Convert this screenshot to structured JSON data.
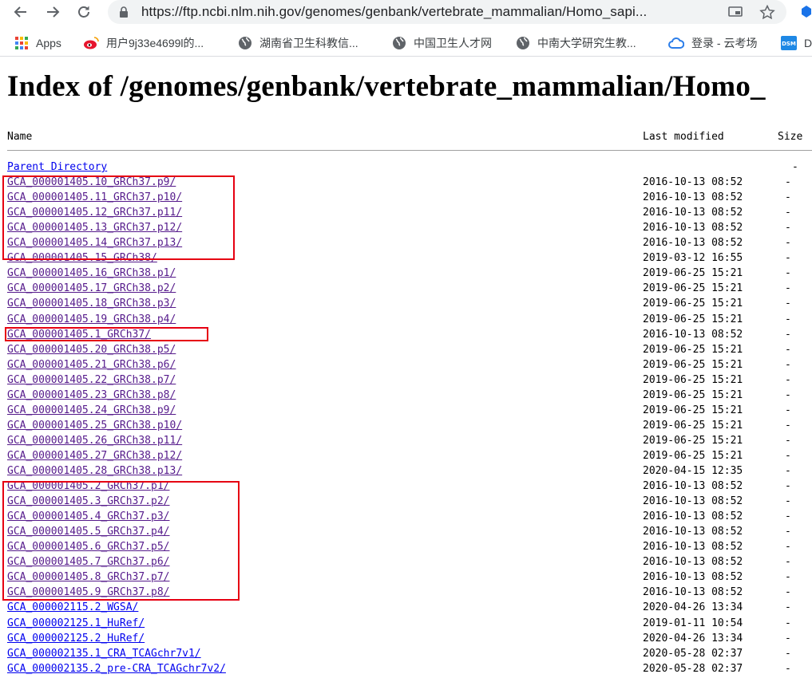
{
  "browser": {
    "url": "https://ftp.ncbi.nlm.nih.gov/genomes/genbank/vertebrate_mammalian/Homo_sapi...",
    "bookmarks": [
      {
        "label": "Apps",
        "icon": "apps-grid-icon"
      },
      {
        "label": "用户9j33e4699l的...",
        "icon": "weibo-icon"
      },
      {
        "label": "湖南省卫生科教信...",
        "icon": "globe-icon"
      },
      {
        "label": "中国卫生人才网",
        "icon": "globe-icon"
      },
      {
        "label": "中南大学研究生教...",
        "icon": "globe-icon"
      },
      {
        "label": "登录 - 云考场",
        "icon": "cloud-icon"
      },
      {
        "label": "D",
        "icon": "dsm-icon"
      }
    ],
    "colors": {
      "omnibox_bg": "#f1f3f4",
      "link_visited": "#551a8b",
      "link_unvisited": "#0000ee",
      "highlight": "#e60012"
    }
  },
  "page": {
    "title": "Index of /genomes/genbank/vertebrate_mammalian/Homo_",
    "columns": {
      "name": "Name",
      "modified": "Last modified",
      "size": "Size"
    },
    "parent": {
      "label": "Parent Directory",
      "size": "-"
    },
    "rows": [
      {
        "name": "GCA_000001405.10_GRCh37.p9/",
        "modified": "2016-10-13 08:52",
        "size": "-"
      },
      {
        "name": "GCA_000001405.11_GRCh37.p10/",
        "modified": "2016-10-13 08:52",
        "size": "-"
      },
      {
        "name": "GCA_000001405.12_GRCh37.p11/",
        "modified": "2016-10-13 08:52",
        "size": "-"
      },
      {
        "name": "GCA_000001405.13_GRCh37.p12/",
        "modified": "2016-10-13 08:52",
        "size": "-"
      },
      {
        "name": "GCA_000001405.14_GRCh37.p13/",
        "modified": "2016-10-13 08:52",
        "size": "-"
      },
      {
        "name": "GCA_000001405.15_GRCh38/",
        "modified": "2019-03-12 16:55",
        "size": "-"
      },
      {
        "name": "GCA_000001405.16_GRCh38.p1/",
        "modified": "2019-06-25 15:21",
        "size": "-"
      },
      {
        "name": "GCA_000001405.17_GRCh38.p2/",
        "modified": "2019-06-25 15:21",
        "size": "-"
      },
      {
        "name": "GCA_000001405.18_GRCh38.p3/",
        "modified": "2019-06-25 15:21",
        "size": "-"
      },
      {
        "name": "GCA_000001405.19_GRCh38.p4/",
        "modified": "2019-06-25 15:21",
        "size": "-"
      },
      {
        "name": "GCA_000001405.1_GRCh37/",
        "modified": "2016-10-13 08:52",
        "size": "-"
      },
      {
        "name": "GCA_000001405.20_GRCh38.p5/",
        "modified": "2019-06-25 15:21",
        "size": "-"
      },
      {
        "name": "GCA_000001405.21_GRCh38.p6/",
        "modified": "2019-06-25 15:21",
        "size": "-"
      },
      {
        "name": "GCA_000001405.22_GRCh38.p7/",
        "modified": "2019-06-25 15:21",
        "size": "-"
      },
      {
        "name": "GCA_000001405.23_GRCh38.p8/",
        "modified": "2019-06-25 15:21",
        "size": "-"
      },
      {
        "name": "GCA_000001405.24_GRCh38.p9/",
        "modified": "2019-06-25 15:21",
        "size": "-"
      },
      {
        "name": "GCA_000001405.25_GRCh38.p10/",
        "modified": "2019-06-25 15:21",
        "size": "-"
      },
      {
        "name": "GCA_000001405.26_GRCh38.p11/",
        "modified": "2019-06-25 15:21",
        "size": "-"
      },
      {
        "name": "GCA_000001405.27_GRCh38.p12/",
        "modified": "2019-06-25 15:21",
        "size": "-"
      },
      {
        "name": "GCA_000001405.28_GRCh38.p13/",
        "modified": "2020-04-15 12:35",
        "size": "-"
      },
      {
        "name": "GCA_000001405.2_GRCh37.p1/",
        "modified": "2016-10-13 08:52",
        "size": "-"
      },
      {
        "name": "GCA_000001405.3_GRCh37.p2/",
        "modified": "2016-10-13 08:52",
        "size": "-"
      },
      {
        "name": "GCA_000001405.4_GRCh37.p3/",
        "modified": "2016-10-13 08:52",
        "size": "-"
      },
      {
        "name": "GCA_000001405.5_GRCh37.p4/",
        "modified": "2016-10-13 08:52",
        "size": "-"
      },
      {
        "name": "GCA_000001405.6_GRCh37.p5/",
        "modified": "2016-10-13 08:52",
        "size": "-"
      },
      {
        "name": "GCA_000001405.7_GRCh37.p6/",
        "modified": "2016-10-13 08:52",
        "size": "-"
      },
      {
        "name": "GCA_000001405.8_GRCh37.p7/",
        "modified": "2016-10-13 08:52",
        "size": "-"
      },
      {
        "name": "GCA_000001405.9_GRCh37.p8/",
        "modified": "2016-10-13 08:52",
        "size": "-"
      },
      {
        "name": "GCA_000002115.2_WGSA/",
        "modified": "2020-04-26 13:34",
        "size": "-"
      },
      {
        "name": "GCA_000002125.1_HuRef/",
        "modified": "2019-01-11 10:54",
        "size": "-"
      },
      {
        "name": "GCA_000002125.2_HuRef/",
        "modified": "2020-04-26 13:34",
        "size": "-"
      },
      {
        "name": "GCA_000002135.1_CRA_TCAGchr7v1/",
        "modified": "2020-05-28 02:37",
        "size": "-"
      },
      {
        "name": "GCA_000002135.2_pre-CRA_TCAGchr7v2/",
        "modified": "2020-05-28 02:37",
        "size": "-"
      }
    ]
  }
}
